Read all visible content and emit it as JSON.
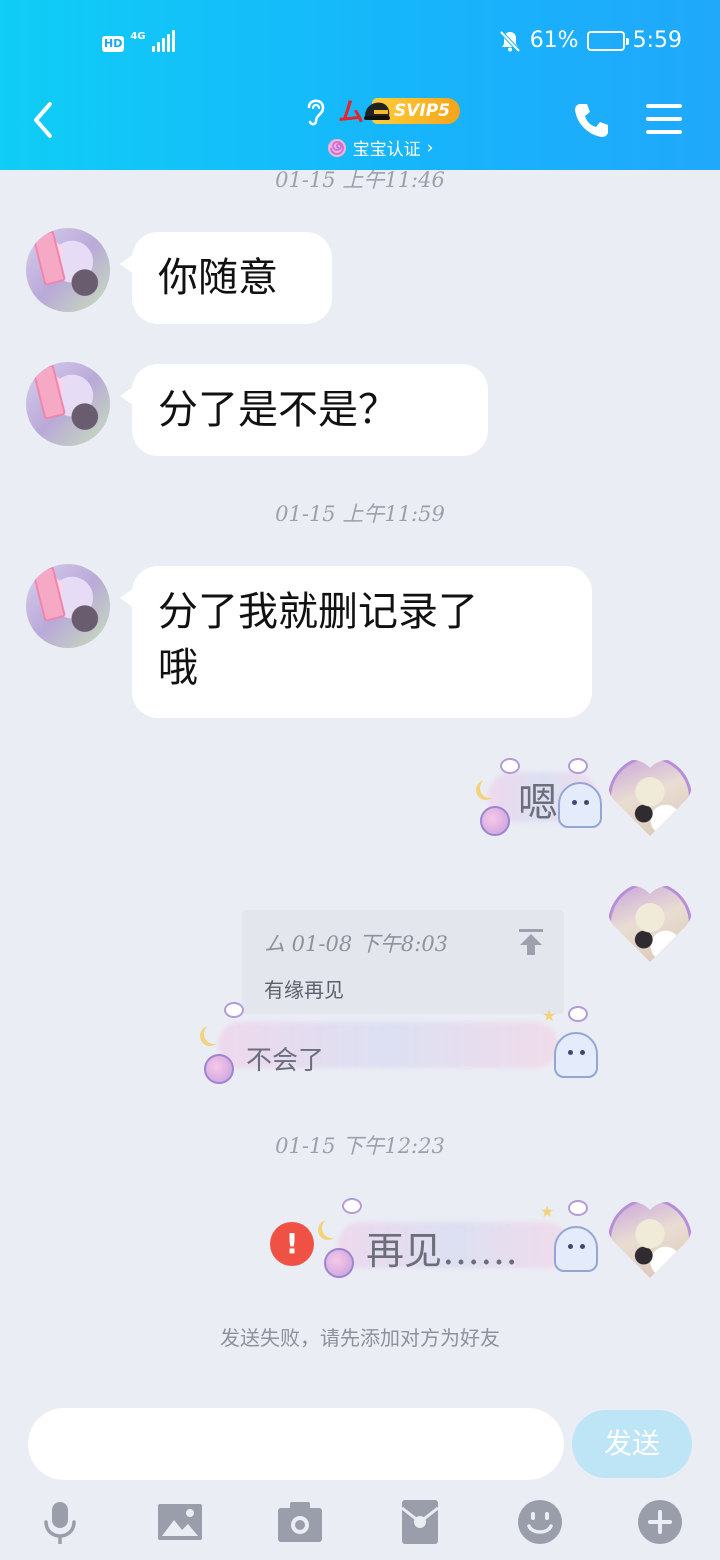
{
  "status_bar": {
    "hd_label": "HD",
    "network_label": "4G",
    "battery_text": "61%",
    "battery_level": 0.61,
    "time": "5:59"
  },
  "header": {
    "title": "ム",
    "vip_badge": "SVIP5",
    "subtitle": "宝宝认证",
    "subtitle_chevron": "›"
  },
  "chat": {
    "top_timestamp": "01-15 上午11:46",
    "messages_left": [
      {
        "text": "你随意"
      },
      {
        "text": "分了是不是？"
      },
      {
        "text_line1": "分了我就删记录了",
        "text_line2": "哦"
      }
    ],
    "timestamp_2": "01-15 上午11:59",
    "sticker_reply_1": "嗯",
    "quote": {
      "header": "ム 01-08 下午8:03",
      "text": "有缘再见"
    },
    "quote_reply": "不会了",
    "timestamp_3": "01-15 下午12:23",
    "failed_message": "再见……",
    "error_mark": "!",
    "system_tip": "发送失败，请先添加对方为好友"
  },
  "composer": {
    "placeholder": "",
    "send_label": "发送"
  },
  "toolbar_icons": [
    "microphone-icon",
    "image-icon",
    "camera-icon",
    "red-packet-icon",
    "emoji-icon",
    "plus-icon"
  ],
  "colors": {
    "header_start": "#0fcdf6",
    "header_end": "#20a8fb",
    "background": "#ebedf5",
    "error": "#f05145",
    "send_button": "#bde5f6",
    "title_red": "#e5242b",
    "vip_gold": "#f3a41a"
  }
}
